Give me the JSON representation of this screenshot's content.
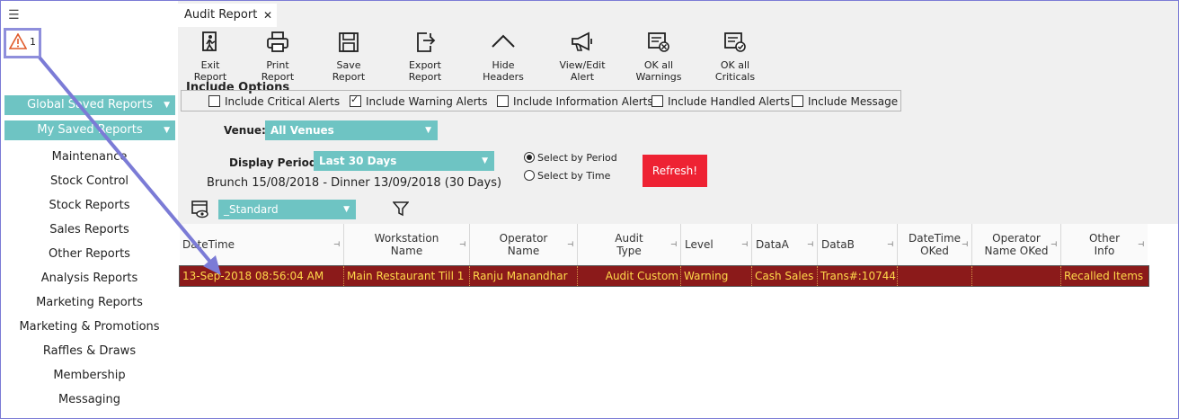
{
  "alerts": {
    "count": "1"
  },
  "sidebar": {
    "global_saved": "Global Saved Reports",
    "my_saved": "My Saved Reports",
    "items": [
      {
        "label": "Maintenance"
      },
      {
        "label": "Stock Control"
      },
      {
        "label": "Stock Reports"
      },
      {
        "label": "Sales Reports"
      },
      {
        "label": "Other Reports"
      },
      {
        "label": "Analysis Reports"
      },
      {
        "label": "Marketing Reports"
      },
      {
        "label": "Marketing & Promotions"
      },
      {
        "label": "Raffles & Draws"
      },
      {
        "label": "Membership"
      },
      {
        "label": "Messaging"
      }
    ]
  },
  "tab": {
    "title": "Audit Report",
    "close": "✕"
  },
  "toolbar": {
    "exit": "Exit Report",
    "print": "Print Report",
    "save": "Save Report",
    "export": "Export Report",
    "hide": "Hide Headers",
    "view_edit": "View/Edit Alert",
    "ok_warnings": "OK all Warnings",
    "ok_criticals": "OK all Criticals"
  },
  "options": {
    "title": "Include Options",
    "critical": "Include Critical Alerts",
    "warning": "Include Warning Alerts",
    "information": "Include Information Alerts",
    "handled": "Include Handled Alerts",
    "message": "Include Message"
  },
  "filters": {
    "venue_label": "Venue:",
    "venue_value": "All Venues",
    "period_label": "Display Period:",
    "period_value": "Last 30 Days",
    "period_range": "Brunch 15/08/2018 - Dinner 13/09/2018 (30 Days)",
    "radio_period": "Select by Period",
    "radio_time": "Select  by Time",
    "refresh": "Refresh!",
    "layout_value": "_Standard"
  },
  "grid": {
    "headers": [
      "DateTime",
      "Workstation Name",
      "Operator Name",
      "Audit Type",
      "Level",
      "DataA",
      "DataB",
      "DateTime OKed",
      "Operator Name OKed",
      "Other Info"
    ],
    "row": [
      "13-Sep-2018 08:56:04 AM",
      "Main Restaurant Till 1",
      "Ranju  Manandhar",
      "Audit Custom",
      "Warning",
      "Cash Sales",
      "Trans#:10744",
      "",
      "",
      "Recalled Items"
    ]
  },
  "colors": {
    "accent": "#6ec4c3",
    "refresh": "#ee2233",
    "row_bg": "#8b1a1a",
    "row_text": "#ffd84a",
    "annotation": "#7b7bd6"
  }
}
